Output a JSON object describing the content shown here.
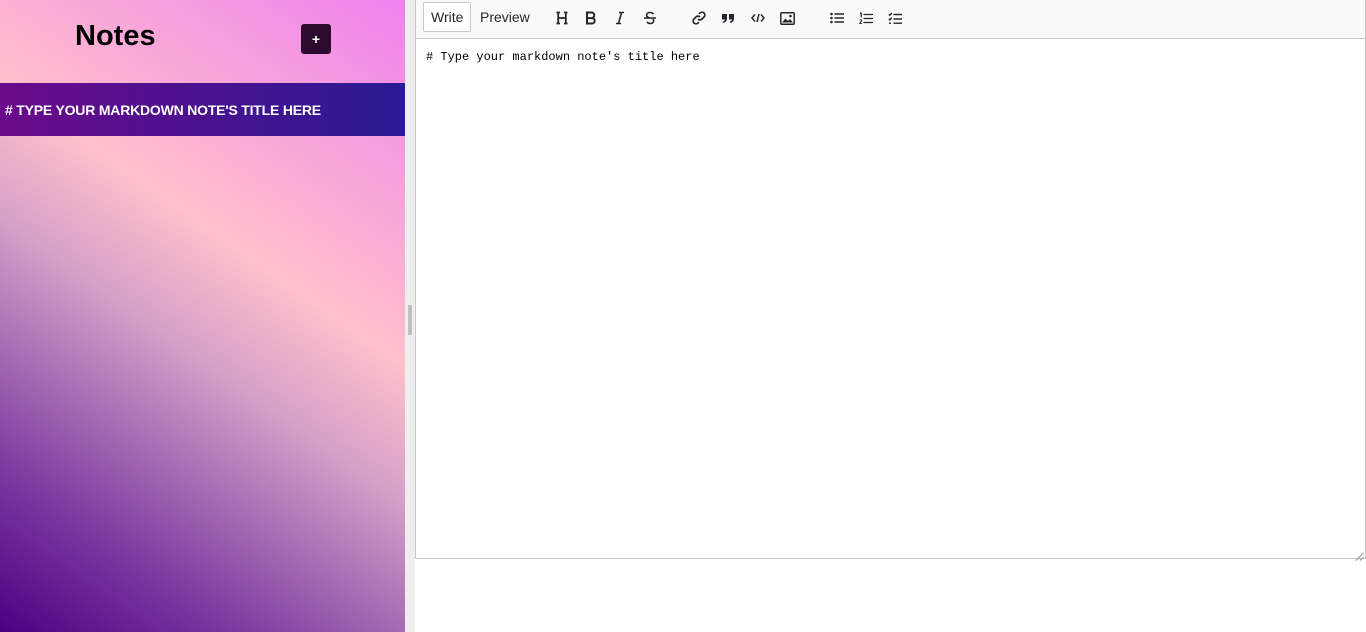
{
  "sidebar": {
    "title": "Notes",
    "new_button_label": "+",
    "notes": [
      {
        "title": "# TYPE YOUR MARKDOWN NOTE'S TITLE HERE"
      }
    ]
  },
  "editor": {
    "tabs": [
      {
        "label": "Write",
        "active": true
      },
      {
        "label": "Preview",
        "active": false
      }
    ],
    "toolbar_icons": [
      "header-icon",
      "bold-icon",
      "italic-icon",
      "strikethrough-icon",
      "link-icon",
      "quote-icon",
      "code-icon",
      "image-icon",
      "unordered-list-icon",
      "ordered-list-icon",
      "checked-list-icon"
    ],
    "content": "# Type your markdown note's title here"
  },
  "colors": {
    "note_bar_start": "#6a0a8a",
    "note_bar_end": "#2a1a94",
    "button_bg": "#2b0a2e"
  }
}
